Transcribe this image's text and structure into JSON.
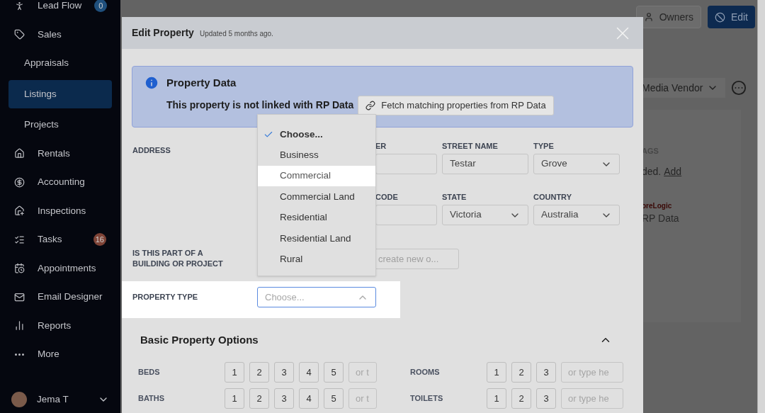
{
  "sidebar": {
    "items": [
      {
        "label": "Lead Flow",
        "selected": false,
        "badge": {
          "text": "0",
          "color": "#1f4f7c"
        }
      },
      {
        "label": "Sales",
        "selected": false,
        "children": [
          {
            "label": "Appraisals",
            "selected": false
          },
          {
            "label": "Listings",
            "selected": true
          },
          {
            "label": "Projects",
            "selected": false
          }
        ]
      },
      {
        "label": "Rentals",
        "selected": false
      },
      {
        "label": "Accounting",
        "selected": false
      },
      {
        "label": "Inspections",
        "selected": false
      },
      {
        "label": "Tasks",
        "selected": false,
        "badge": {
          "text": "16",
          "color": "#7e4336"
        }
      },
      {
        "label": "Appointments",
        "selected": false
      },
      {
        "label": "Email Designer",
        "selected": false
      },
      {
        "label": "Reports",
        "selected": false
      },
      {
        "label": "More",
        "selected": false
      }
    ],
    "user": {
      "name": "Jema T"
    }
  },
  "page": {
    "buttons": [
      "Owners",
      "Edit"
    ],
    "role_select": "Media Vendor",
    "tags_label": "AGS",
    "tags_text": "ded.",
    "tags_link": "Add",
    "source_logo": "oreLogic",
    "source_name": "RP Data"
  },
  "modal": {
    "title": "Edit Property",
    "subtitle": "Updated 5 months ago.",
    "notice": {
      "title": "Property Data",
      "text": "This property is not linked with RP Data",
      "button": "Fetch matching properties from RP Data"
    },
    "address": {
      "label": "ADDRESS",
      "rows": [
        [
          {
            "label": "ER",
            "kind": "input"
          },
          {
            "label": "STREET NAME",
            "kind": "input",
            "value": "Testar"
          },
          {
            "label": "TYPE",
            "kind": "select",
            "value": "Grove"
          }
        ],
        [
          {
            "label": "CODE",
            "kind": "input"
          },
          {
            "label": "STATE",
            "kind": "select",
            "value": "Victoria"
          },
          {
            "label": "COUNTRY",
            "kind": "select",
            "value": "Australia"
          }
        ]
      ]
    },
    "building": {
      "label": "IS THIS PART OF A BUILDING OR PROJECT",
      "placeholder": "create new o..."
    },
    "property_type": {
      "label": "PROPERTY TYPE",
      "placeholder": "Choose...",
      "expanded": true,
      "options": [
        {
          "label": "Choose...",
          "selected": true,
          "highlighted": false
        },
        {
          "label": "Business",
          "selected": false,
          "highlighted": false
        },
        {
          "label": "Commercial",
          "selected": false,
          "highlighted": true
        },
        {
          "label": "Commercial Land",
          "selected": false,
          "highlighted": false
        },
        {
          "label": "Residential",
          "selected": false,
          "highlighted": false
        },
        {
          "label": "Residential Land",
          "selected": false,
          "highlighted": false
        },
        {
          "label": "Rural",
          "selected": false,
          "highlighted": false
        }
      ]
    },
    "basic_options": {
      "title": "Basic Property Options",
      "expanded": true,
      "left": [
        {
          "label": "BEDS",
          "choices": [
            "1",
            "2",
            "3",
            "4",
            "5"
          ],
          "placeholder": "or t"
        },
        {
          "label": "BATHS",
          "choices": [
            "1",
            "2",
            "3",
            "4",
            "5"
          ],
          "placeholder": "or t"
        }
      ],
      "right": [
        {
          "label": "ROOMS",
          "choices": [
            "1",
            "2",
            "3"
          ],
          "placeholder": "or type he"
        },
        {
          "label": "TOILETS",
          "choices": [
            "1",
            "2",
            "3"
          ],
          "placeholder": "or type he"
        }
      ]
    }
  }
}
